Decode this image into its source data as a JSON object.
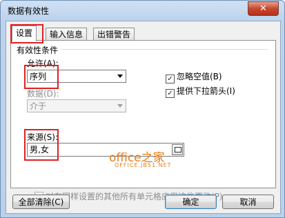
{
  "window": {
    "title": "数据有效性",
    "close_glyph": "✕"
  },
  "tabs": [
    {
      "label": "设置",
      "active": true
    },
    {
      "label": "输入信息",
      "active": false
    },
    {
      "label": "出错警告",
      "active": false
    }
  ],
  "settings": {
    "group_label": "有效性条件",
    "allow_label": "允许(A):",
    "allow_value": "序列",
    "data_label": "数据(D):",
    "data_value": "介于",
    "ignore_blank_label": "忽略空值(B)",
    "ignore_blank_checked": true,
    "dropdown_label": "提供下拉箭头(I)",
    "dropdown_checked": true,
    "source_label": "来源(S):",
    "source_value": "男,女",
    "apply_all_label": "对有同样设置的其他所有单元格应用这些更改(P)",
    "apply_all_checked": false
  },
  "watermark": {
    "brand": "office之家",
    "site": "OFFICE.JB51.NET"
  },
  "buttons": {
    "clear_all": "全部清除(C)",
    "ok": "确定",
    "cancel": "取消"
  },
  "colors": {
    "highlight_box": "#e02020",
    "watermark": "#e87b14"
  }
}
